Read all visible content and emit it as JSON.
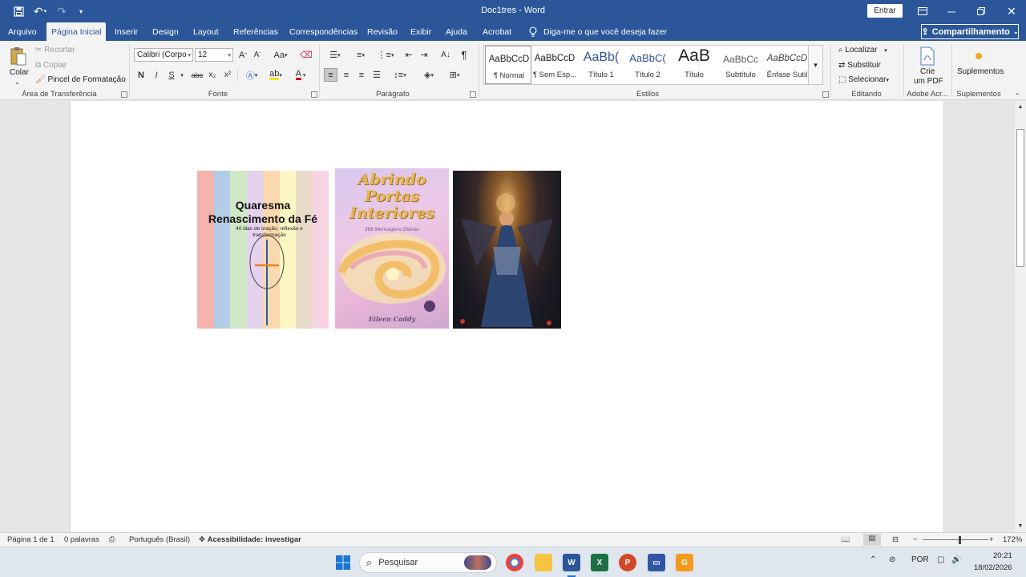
{
  "titlebar": {
    "doc_title": "Doc1tres  -  Word",
    "signin_label": "Entrar"
  },
  "tabs": [
    {
      "label": "Arquivo"
    },
    {
      "label": "Página Inicial"
    },
    {
      "label": "Inserir"
    },
    {
      "label": "Design"
    },
    {
      "label": "Layout"
    },
    {
      "label": "Referências"
    },
    {
      "label": "Correspondências"
    },
    {
      "label": "Revisão"
    },
    {
      "label": "Exibir"
    },
    {
      "label": "Ajuda"
    },
    {
      "label": "Acrobat"
    }
  ],
  "tell_me": "Diga-me o que você deseja fazer",
  "share_label": "Compartilhamento",
  "clipboard": {
    "paste": "Colar",
    "cut": "Recortar",
    "copy": "Copiar",
    "format_painter": "Pincel de Formatação",
    "group": "Área de Transferência"
  },
  "font": {
    "name": "Calibri (Corpo",
    "size": "12",
    "bold": "N",
    "italic": "I",
    "underline": "S",
    "strike": "abc",
    "sub": "x₂",
    "sup": "x²",
    "grow": "A^",
    "shrink": "Aˇ",
    "case": "Aa",
    "group": "Fonte"
  },
  "paragraph": {
    "group": "Parágrafo"
  },
  "styles": {
    "items": [
      {
        "sample": "AaBbCcD",
        "name": "¶ Normal"
      },
      {
        "sample": "AaBbCcD",
        "name": "¶ Sem Esp..."
      },
      {
        "sample": "AaBb(",
        "name": "Título 1"
      },
      {
        "sample": "AaBbC(",
        "name": "Título 2"
      },
      {
        "sample": "AaB",
        "name": "Título"
      },
      {
        "sample": "AaBbCc",
        "name": "Subtítulo"
      },
      {
        "sample": "AaBbCcD",
        "name": "Ênfase Sutil"
      }
    ],
    "group": "Estilos"
  },
  "editing": {
    "find": "Localizar",
    "replace": "Substituir",
    "select": "Selecionar",
    "group": "Editando"
  },
  "adobe": {
    "create_pdf_line1": "Crie",
    "create_pdf_line2": "um PDF",
    "group": "Adobe Acr..."
  },
  "addins": {
    "label": "Suplementos",
    "group": "Suplementos"
  },
  "document": {
    "book1": {
      "title_line1": "Quaresma",
      "title_line2": "Renascimento da Fé",
      "subtitle": "40 dias de oração, reflexão e transformação",
      "stripe_colors": [
        "#f4b3ad",
        "#b4cde6",
        "#cfe8c6",
        "#e4d2ee",
        "#fbd9ae",
        "#fbf6c2",
        "#e8dcc8",
        "#f8d3e4"
      ]
    },
    "book2": {
      "title": "Abrindo Portas Interiores",
      "subtitle": "366 Mensagens Diárias",
      "author": "Eileen Caddy"
    }
  },
  "statusbar": {
    "page": "Página 1 de 1",
    "words": "0 palavras",
    "language": "Português (Brasil)",
    "accessibility": "Acessibilidade: investigar",
    "zoom": "172%"
  },
  "taskbar": {
    "search_placeholder": "Pesquisar",
    "language": "POR",
    "time": "20:21",
    "date": "18/02/2026"
  }
}
